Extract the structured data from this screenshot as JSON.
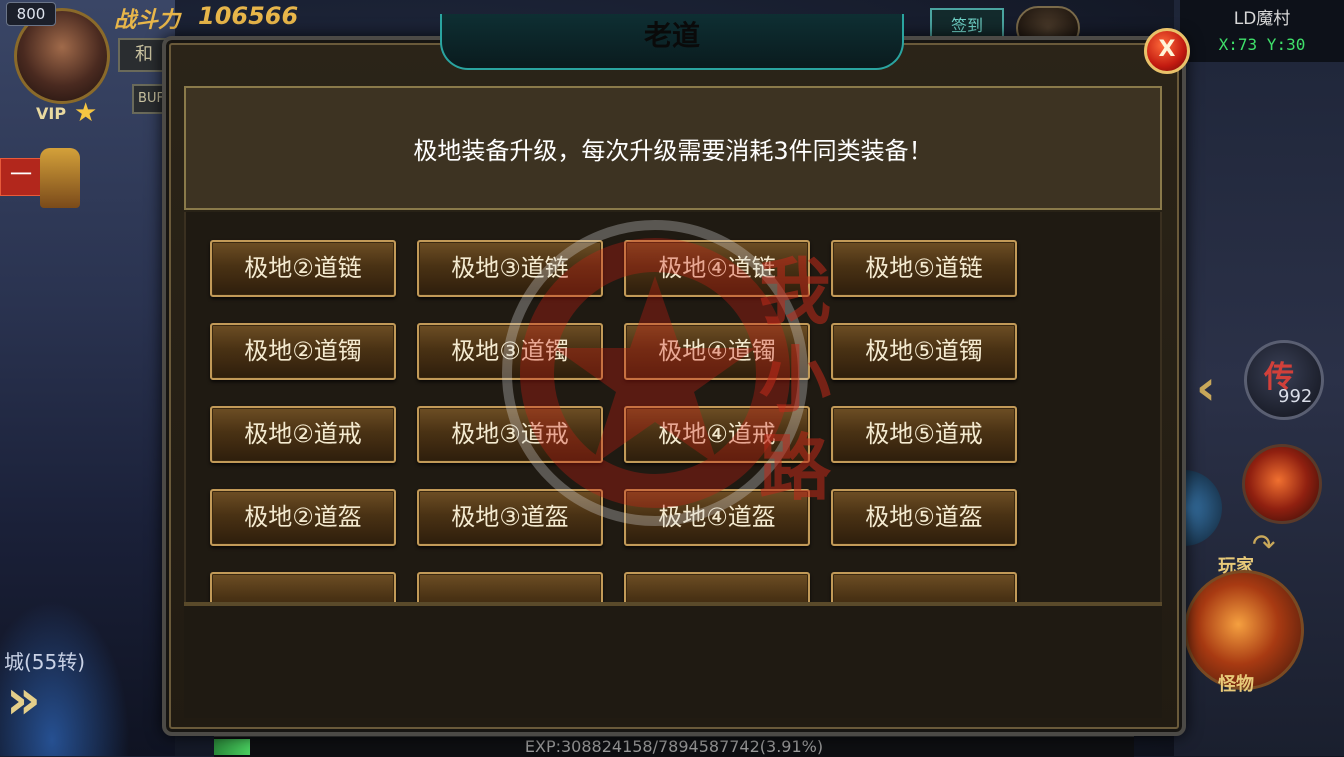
{
  "hud": {
    "level": "800",
    "vip_label": "VIP",
    "power_label": "战斗力",
    "power_value": "106566",
    "mode_button": "和",
    "buff_button": "BUF",
    "side_tab": "一",
    "city_text": "城(55转)"
  },
  "map": {
    "name": "LD魔村",
    "coords": "X:73 Y:30"
  },
  "top_buttons": {
    "mini_button": "签到"
  },
  "right_hud": {
    "legend_icon": "传",
    "legend_count": "992",
    "player_label": "玩家",
    "monster_label": "怪物"
  },
  "dialog": {
    "title": "老道",
    "close_label": "X",
    "notice": "极地装备升级，每次升级需要消耗3件同类装备！",
    "rows": [
      [
        "极地②道链",
        "极地③道链",
        "极地④道链",
        "极地⑤道链"
      ],
      [
        "极地②道镯",
        "极地③道镯",
        "极地④道镯",
        "极地⑤道镯"
      ],
      [
        "极地②道戒",
        "极地③道戒",
        "极地④道戒",
        "极地⑤道戒"
      ],
      [
        "极地②道盔",
        "极地③道盔",
        "极地④道盔",
        "极地⑤道盔"
      ],
      [
        "",
        "",
        "",
        ""
      ]
    ]
  },
  "exp": {
    "text": "EXP:308824158/7894587742(3.91%)",
    "progress": 0.0391
  },
  "watermark": {
    "text_vertical": "我\n小\n路",
    "circle_text": "WWW.WOSTIA.NET"
  },
  "colors": {
    "button_border": "#c29a58",
    "button_text": "#f4ead0",
    "title_accent": "#2aa4a0",
    "close_button": "#c21a10",
    "coords_text": "#3fe06a",
    "power_text": "#e8b64a"
  }
}
